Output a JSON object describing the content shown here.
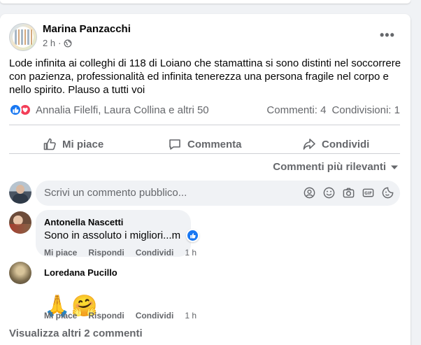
{
  "post": {
    "author": "Marina Panzacchi",
    "time": "2 h",
    "separator": "·",
    "text": "Lode infinita ai colleghi di 118 di Loiano che stamattina si sono distinti nel soccorrere con pazienza, professionalità ed infinita tenerezza una persona fragile nel corpo e nello spirito. Plauso a tutti voi",
    "more_label": "•••",
    "reactions_names": "Annalia Filelfi, Laura Collina e altri 50",
    "comments_count": "Commenti: 4",
    "shares_count": "Condivisioni: 1"
  },
  "actions": {
    "like": "Mi piace",
    "comment": "Commenta",
    "share": "Condividi"
  },
  "comments_section": {
    "sort_label": "Commenti più rilevanti",
    "input_placeholder": "Scrivi un commento pubblico...",
    "input_icons": [
      "avatar-sticker-icon",
      "smiley-icon",
      "camera-icon",
      "gif-icon",
      "sticker-icon"
    ],
    "view_more": "Visualizza altri 2 commenti"
  },
  "comments": [
    {
      "author": "Antonella Nascetti",
      "text": "Sono in assoluto i migliori...m",
      "like": "Mi piace",
      "reply": "Rispondi",
      "share": "Condividi",
      "time": "1 h"
    },
    {
      "author": "Loredana Pucillo",
      "emojis": [
        "🙏",
        "🤗"
      ],
      "like": "Mi piace",
      "reply": "Rispondi",
      "share": "Condividi",
      "time": "1 h"
    }
  ],
  "colors": {
    "brand_blue": "#1877f2",
    "love_red": "#f33e58",
    "secondary_text": "#65676b",
    "background": "#f0f2f5"
  }
}
